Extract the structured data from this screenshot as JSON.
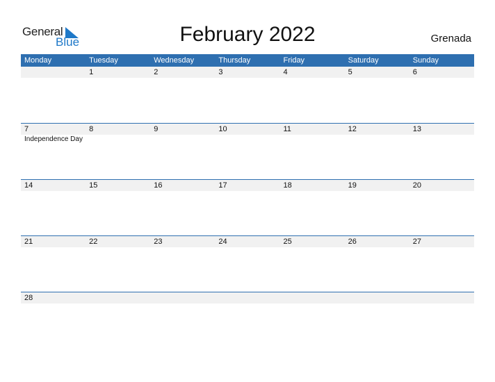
{
  "logo": {
    "general": "General",
    "blue": "Blue"
  },
  "title": "February 2022",
  "country": "Grenada",
  "colors": {
    "header": "#2e6fb0",
    "row_bg": "#f1f1f1",
    "logo_blue": "#1e78c8"
  },
  "weekdays": [
    "Monday",
    "Tuesday",
    "Wednesday",
    "Thursday",
    "Friday",
    "Saturday",
    "Sunday"
  ],
  "weeks": [
    {
      "dates": [
        "",
        "1",
        "2",
        "3",
        "4",
        "5",
        "6"
      ],
      "events": [
        "",
        "",
        "",
        "",
        "",
        "",
        ""
      ]
    },
    {
      "dates": [
        "7",
        "8",
        "9",
        "10",
        "11",
        "12",
        "13"
      ],
      "events": [
        "Independence Day",
        "",
        "",
        "",
        "",
        "",
        ""
      ]
    },
    {
      "dates": [
        "14",
        "15",
        "16",
        "17",
        "18",
        "19",
        "20"
      ],
      "events": [
        "",
        "",
        "",
        "",
        "",
        "",
        ""
      ]
    },
    {
      "dates": [
        "21",
        "22",
        "23",
        "24",
        "25",
        "26",
        "27"
      ],
      "events": [
        "",
        "",
        "",
        "",
        "",
        "",
        ""
      ]
    },
    {
      "dates": [
        "28",
        "",
        "",
        "",
        "",
        "",
        ""
      ],
      "events": [
        "",
        "",
        "",
        "",
        "",
        "",
        ""
      ]
    }
  ]
}
